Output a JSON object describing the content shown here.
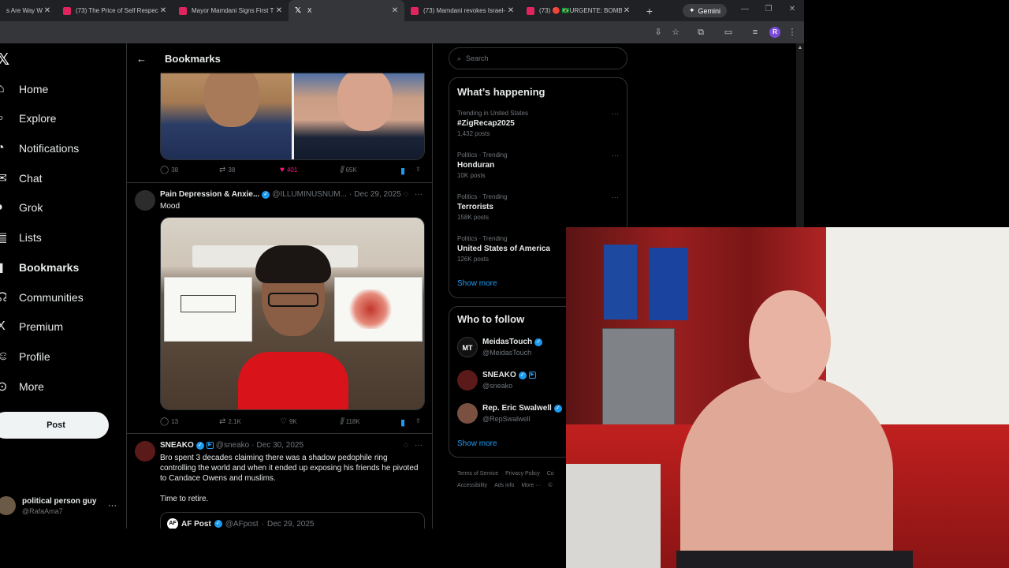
{
  "browser": {
    "tabs": [
      {
        "title": "s Are Way W",
        "icon": "youtube-icon",
        "active": false
      },
      {
        "title": "(73) The Price of Self Respec",
        "icon": "youtube-icon",
        "active": false
      },
      {
        "title": "Mayor Mamdani Signs First T",
        "icon": "youtube-icon",
        "active": false
      },
      {
        "title": "X",
        "icon": "x-icon",
        "active": true
      },
      {
        "title": "(73) Mamdani revokes Israel-",
        "icon": "youtube-icon",
        "active": false
      },
      {
        "title": "(73) 🔴 🇧🇷URGENTE: BOMB",
        "icon": "youtube-icon",
        "active": false
      }
    ],
    "gemini_label": "Gemini",
    "profile_initial": "R"
  },
  "nav": {
    "items": [
      {
        "label": "Home",
        "icon": "home-icon",
        "active": false
      },
      {
        "label": "Explore",
        "icon": "search-icon",
        "active": false
      },
      {
        "label": "Notifications",
        "icon": "bell-icon",
        "active": false
      },
      {
        "label": "Chat",
        "icon": "chat-icon",
        "active": false
      },
      {
        "label": "Grok",
        "icon": "grok-icon",
        "active": false
      },
      {
        "label": "Lists",
        "icon": "list-icon",
        "active": false
      },
      {
        "label": "Bookmarks",
        "icon": "bookmark-icon",
        "active": true
      },
      {
        "label": "Communities",
        "icon": "communities-icon",
        "active": false
      },
      {
        "label": "Premium",
        "icon": "x-icon",
        "active": false
      },
      {
        "label": "Profile",
        "icon": "person-icon",
        "active": false
      },
      {
        "label": "More",
        "icon": "more-circle-icon",
        "active": false
      }
    ],
    "post_label": "Post",
    "account": {
      "name": "political person guy",
      "handle": "@RafaAma7"
    }
  },
  "main": {
    "title": "Bookmarks",
    "tweet1_actions": {
      "replies": "38",
      "reposts": "38",
      "likes": "401",
      "views": "65K"
    },
    "tweet2": {
      "name": "Pain Depression & Anxie...",
      "handle": "@ILLUMINUSNUM...",
      "date": "Dec 29, 2025",
      "text": "Mood",
      "actions": {
        "replies": "13",
        "reposts": "2.1K",
        "likes": "9K",
        "views": "118K"
      }
    },
    "tweet3": {
      "name": "SNEAKO",
      "handle": "@sneako",
      "date": "Dec 30, 2025",
      "text": "Bro spent 3 decades claiming there was a shadow pedophile ring controlling the world and when it ended up exposing his friends he pivoted to Candace Owens and muslims.",
      "text2": "Time to retire.",
      "quote": {
        "name": "AF Post",
        "handle": "@AFpost",
        "date": "Dec 29, 2025"
      }
    }
  },
  "sidebar": {
    "search_placeholder": "Search",
    "happening_title": "What’s happening",
    "trends": [
      {
        "context": "Trending in United States",
        "name": "#ZigRecap2025",
        "count": "1,432 posts"
      },
      {
        "context": "Politics · Trending",
        "name": "Honduran",
        "count": "10K posts"
      },
      {
        "context": "Politics · Trending",
        "name": "Terrorists",
        "count": "158K posts"
      },
      {
        "context": "Politics · Trending",
        "name": "United States of America",
        "count": "126K posts"
      }
    ],
    "show_more": "Show more",
    "follow_title": "Who to follow",
    "follow": [
      {
        "name": "MeidasTouch",
        "handle": "@MeidasTouch",
        "avatar_text": "MT"
      },
      {
        "name": "SNEAKO",
        "handle": "@sneako",
        "avatar_text": ""
      },
      {
        "name": "Rep. Eric Swalwell",
        "handle": "@RepSwalwell",
        "avatar_text": ""
      }
    ],
    "follow_show_more": "Show more",
    "footer": [
      "Terms of Service",
      "Privacy Policy",
      "Co",
      "Accessibility",
      "Ads info",
      "More ···",
      "©"
    ]
  },
  "colors": {
    "accent": "#1d9bf0",
    "like": "#f91880",
    "bg": "#000000"
  }
}
